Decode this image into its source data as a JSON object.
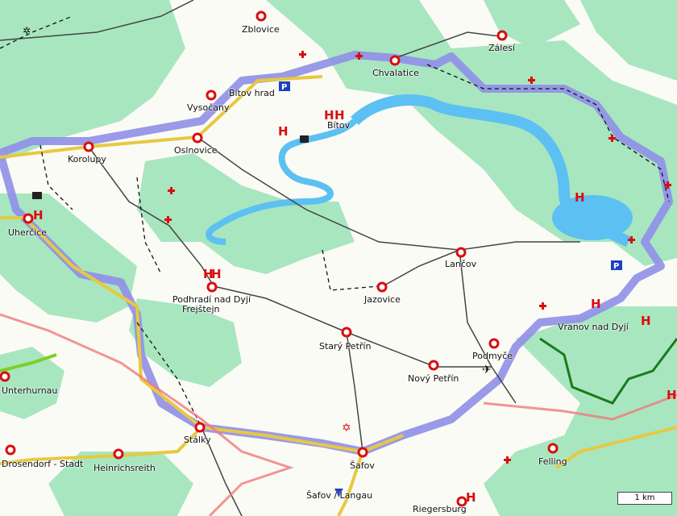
{
  "map": {
    "colors": {
      "background": "#fbfbf6",
      "forest": "#a8e6c0",
      "water": "#5cc0f2",
      "park_boundary": "#8f8fe8",
      "main_road": "#e8c842",
      "border_pink": "#f07b7b",
      "national_border_green": "#197b19",
      "poi_red": "#d90d0d"
    },
    "places": [
      {
        "name": "Zblovice"
      },
      {
        "name": "Zálesí"
      },
      {
        "name": "Chvalatice"
      },
      {
        "name": "Bítov hrad"
      },
      {
        "name": "Vysočany"
      },
      {
        "name": "Bítov"
      },
      {
        "name": "Korolupy"
      },
      {
        "name": "Oslnovice"
      },
      {
        "name": "Uherčice"
      },
      {
        "name": "Lančov"
      },
      {
        "name": "Podhradí nad Dyjí"
      },
      {
        "name": "Frejštejn"
      },
      {
        "name": "Jazovice"
      },
      {
        "name": "Starý Petřín"
      },
      {
        "name": "Podmyče"
      },
      {
        "name": "Nový Petřín"
      },
      {
        "name": "Vranov nad Dyjí"
      },
      {
        "name": "Unterhurnau"
      },
      {
        "name": "Drosendorf - Stadt"
      },
      {
        "name": "Heinrichsreith"
      },
      {
        "name": "Stálky"
      },
      {
        "name": "Šafov"
      },
      {
        "name": "Felling"
      },
      {
        "name": "Šafov / Langau"
      },
      {
        "name": "Riegersburg"
      }
    ],
    "scale_label": "1 km"
  }
}
